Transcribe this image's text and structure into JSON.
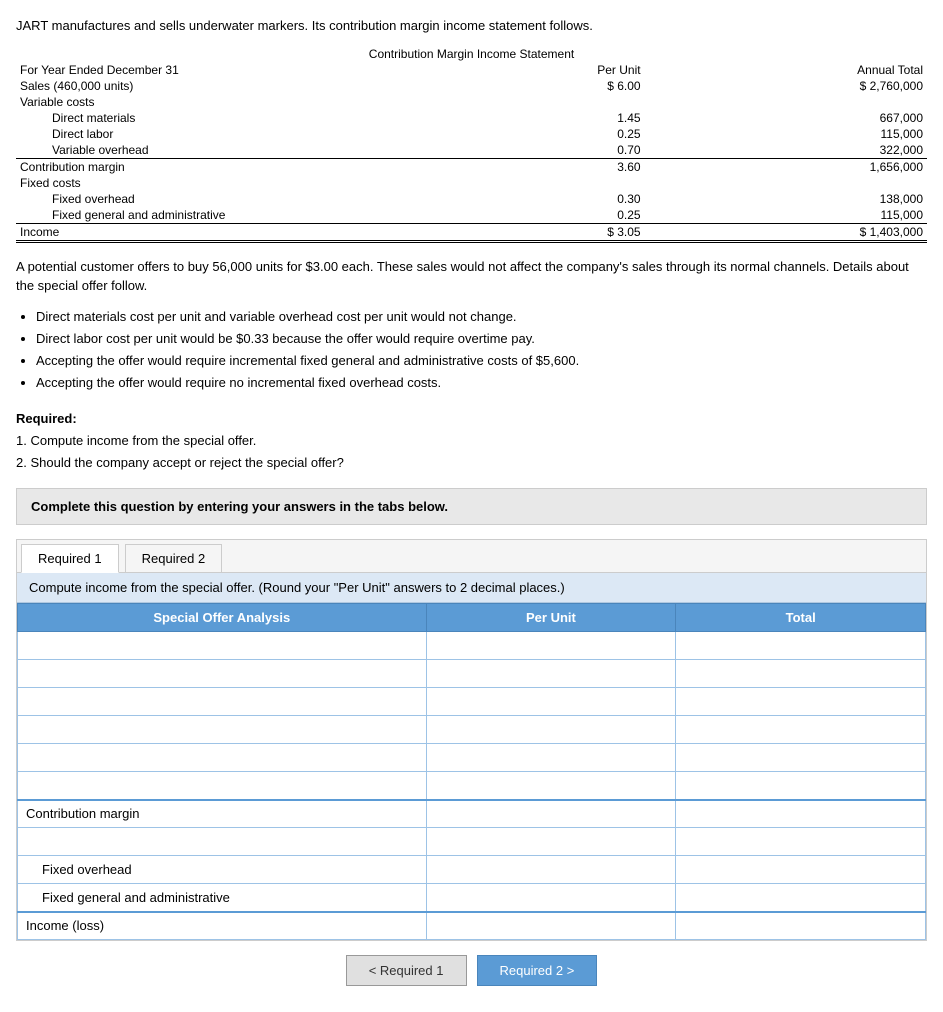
{
  "intro": {
    "paragraph1": "JART manufactures and sells underwater markers. Its contribution margin income statement follows.",
    "table_title": "Contribution Margin Income Statement",
    "table_rows": [
      {
        "label": "For Year Ended December 31",
        "per_unit": "Per Unit",
        "annual": "Annual Total",
        "indent": 0,
        "header": true
      },
      {
        "label": "Sales (460,000 units)",
        "per_unit": "$ 6.00",
        "annual": "$ 2,760,000",
        "indent": 0
      },
      {
        "label": "Variable costs",
        "per_unit": "",
        "annual": "",
        "indent": 0
      },
      {
        "label": "Direct materials",
        "per_unit": "1.45",
        "annual": "667,000",
        "indent": 2
      },
      {
        "label": "Direct labor",
        "per_unit": "0.25",
        "annual": "115,000",
        "indent": 2
      },
      {
        "label": "Variable overhead",
        "per_unit": "0.70",
        "annual": "322,000",
        "indent": 2
      },
      {
        "label": "Contribution margin",
        "per_unit": "3.60",
        "annual": "1,656,000",
        "indent": 0,
        "border_top": true
      },
      {
        "label": "Fixed costs",
        "per_unit": "",
        "annual": "",
        "indent": 0
      },
      {
        "label": "Fixed overhead",
        "per_unit": "0.30",
        "annual": "138,000",
        "indent": 2
      },
      {
        "label": "Fixed general and administrative",
        "per_unit": "0.25",
        "annual": "115,000",
        "indent": 2
      },
      {
        "label": "Income",
        "per_unit": "$ 3.05",
        "annual": "$ 1,403,000",
        "indent": 0,
        "border_top": true,
        "double_bottom": true
      }
    ],
    "paragraph2": "A potential customer offers to buy 56,000 units for $3.00 each. These sales would not affect the company's sales through its normal channels. Details about the special offer follow.",
    "bullets": [
      "Direct materials cost per unit and variable overhead cost per unit would not change.",
      "Direct labor cost per unit would be $0.33 because the offer would require overtime pay.",
      "Accepting the offer would require incremental fixed general and administrative costs of $5,600.",
      "Accepting the offer would require no incremental fixed overhead costs."
    ]
  },
  "required_section": {
    "title": "Required:",
    "items": [
      "1. Compute income from the special offer.",
      "2. Should the company accept or reject the special offer?"
    ]
  },
  "complete_box": {
    "text": "Complete this question by entering your answers in the tabs below."
  },
  "tabs": [
    {
      "label": "Required 1",
      "active": true
    },
    {
      "label": "Required 2",
      "active": false
    }
  ],
  "instruction": "Compute income from the special offer. (Round your \"Per Unit\" answers to 2 decimal places.)",
  "data_table": {
    "headers": [
      "Special Offer Analysis",
      "Per Unit",
      "Total"
    ],
    "rows": [
      {
        "label": "",
        "per_unit": "",
        "total": "",
        "type": "input"
      },
      {
        "label": "",
        "per_unit": "",
        "total": "",
        "type": "input"
      },
      {
        "label": "",
        "per_unit": "",
        "total": "",
        "type": "input"
      },
      {
        "label": "",
        "per_unit": "",
        "total": "",
        "type": "input"
      },
      {
        "label": "",
        "per_unit": "",
        "total": "",
        "type": "input"
      },
      {
        "label": "",
        "per_unit": "",
        "total": "",
        "type": "input"
      },
      {
        "label": "Contribution margin",
        "per_unit": "",
        "total": "",
        "type": "contribution"
      },
      {
        "label": "",
        "per_unit": "",
        "total": "",
        "type": "input"
      },
      {
        "label": "  Fixed overhead",
        "per_unit": "",
        "total": "",
        "type": "indent"
      },
      {
        "label": "  Fixed general and administrative",
        "per_unit": "",
        "total": "",
        "type": "indent"
      },
      {
        "label": "Income (loss)",
        "per_unit": "",
        "total": "",
        "type": "income"
      }
    ]
  },
  "buttons": {
    "prev_label": "< Required 1",
    "next_label": "Required 2 >"
  }
}
